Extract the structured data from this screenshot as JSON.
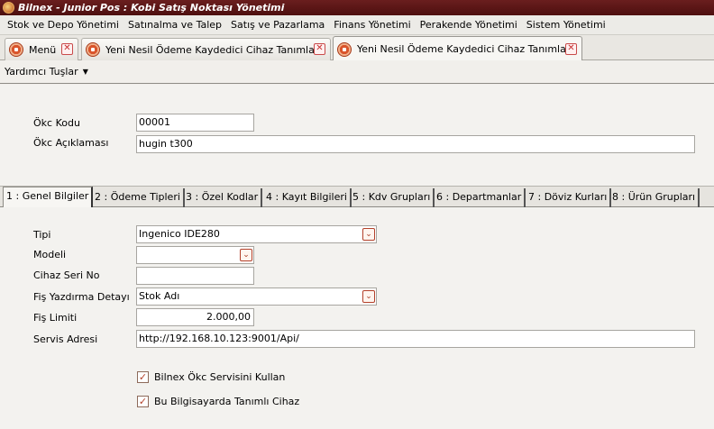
{
  "window": {
    "title": "Bilnex - Junior Pos : Kobi Satış Noktası Yönetimi"
  },
  "menubar": {
    "items": [
      "Stok ve Depo Yönetimi",
      "Satınalma ve Talep",
      "Satış ve Pazarlama",
      "Finans Yönetimi",
      "Perakende Yönetimi",
      "Sistem Yönetimi"
    ]
  },
  "doc_tabs": [
    {
      "label": "Menü",
      "close": "✕"
    },
    {
      "label": "Yeni Nesil Ödeme Kaydedici Cihaz Tanımları",
      "close": "✕"
    },
    {
      "label": "Yeni Nesil Ödeme Kaydedici Cihaz Tanımları",
      "close": "✕"
    }
  ],
  "toolbar": {
    "helper_keys_label": "Yardımcı Tuşlar",
    "arrow": "▼"
  },
  "header": {
    "okc_kodu": {
      "label": "Ökc Kodu",
      "value": "00001"
    },
    "okc_aciklamasi": {
      "label": "Ökc Açıklaması",
      "value": "hugin t300"
    }
  },
  "sub_tabs": [
    "1 : Genel Bilgiler",
    "2 : Ödeme Tipleri",
    "3 : Özel Kodlar",
    "4 : Kayıt Bilgileri",
    "5 : Kdv Grupları",
    "6 : Departmanlar",
    "7 : Döviz Kurları",
    "8 : Ürün Grupları"
  ],
  "general": {
    "tipi": {
      "label": "Tipi",
      "value": "Ingenico IDE280"
    },
    "modeli": {
      "label": "Modeli",
      "value": ""
    },
    "cihaz_seri_no": {
      "label": "Cihaz Seri No",
      "value": ""
    },
    "fis_yazdirma_detayi": {
      "label": "Fiş Yazdırma Detayı",
      "value": "Stok Adı"
    },
    "fis_limiti": {
      "label": "Fiş Limiti",
      "value": "2.000,00"
    },
    "servis_adresi": {
      "label": "Servis Adresi",
      "value": "http://192.168.10.123:9001/Api/"
    },
    "use_service_checkbox": {
      "label": "Bilnex Ökc Servisini Kullan",
      "checked": true,
      "mark": "✓"
    },
    "this_pc_checkbox": {
      "label": "Bu Bilgisayarda Tanımlı Cihaz",
      "checked": true,
      "mark": "✓"
    },
    "combo_arrow": "⌄"
  },
  "colors": {
    "titlebar": "#5c1414",
    "accent_red": "#b3412b",
    "background": "#f3f2ef"
  }
}
